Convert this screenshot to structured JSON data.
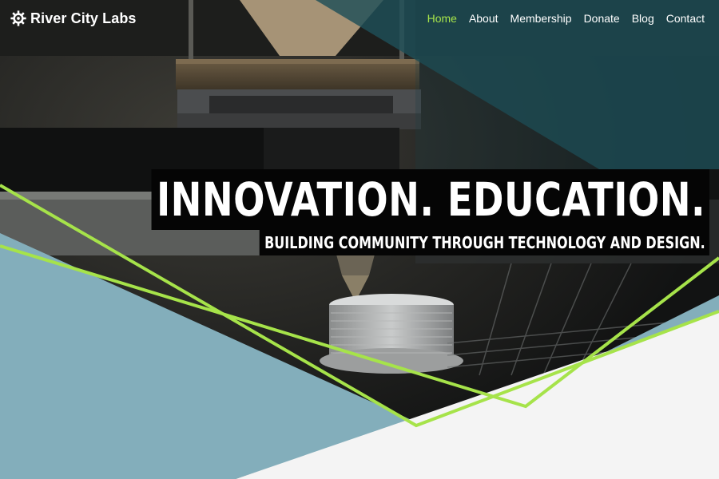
{
  "site": {
    "brand_name": "River City Labs",
    "brand_icon": "gear-icon"
  },
  "nav": {
    "items": [
      {
        "label": "Home",
        "active": true
      },
      {
        "label": "About",
        "active": false
      },
      {
        "label": "Membership",
        "active": false
      },
      {
        "label": "Donate",
        "active": false
      },
      {
        "label": "Blog",
        "active": false
      },
      {
        "label": "Contact",
        "active": false
      }
    ]
  },
  "hero": {
    "headline": "INNOVATION. EDUCATION.",
    "subheadline": "BUILDING COMMUNITY THROUGH TECHNOLOGY AND DESIGN.",
    "image_subject": "3d-printer-nozzle-photo"
  },
  "colors": {
    "accent": "#a6e34a",
    "teal": "#83aebb",
    "dark_teal_overlay": "#1f4f58",
    "light_panel": "#f4f4f4",
    "text_bg": "#050505"
  }
}
